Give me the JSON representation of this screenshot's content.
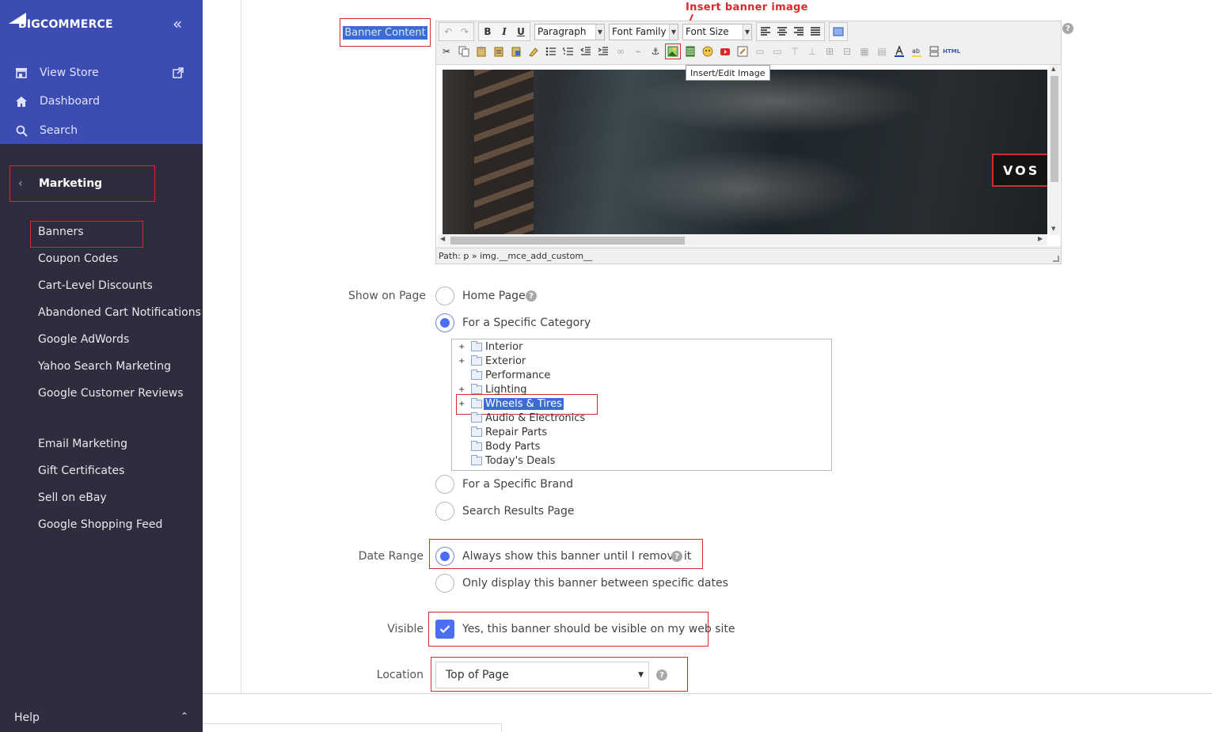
{
  "sidebar": {
    "brand": "BIGCOMMERCE",
    "top_links": [
      {
        "label": "View Store",
        "icon": "storefront-icon"
      },
      {
        "label": "Dashboard",
        "icon": "home-icon"
      },
      {
        "label": "Search",
        "icon": "search-icon"
      }
    ],
    "section": "Marketing",
    "items": [
      "Banners",
      "Coupon Codes",
      "Cart-Level Discounts",
      "Abandoned Cart Notifications",
      "Google AdWords",
      "Yahoo Search Marketing",
      "Google Customer Reviews",
      "Email Marketing",
      "Gift Certificates",
      "Sell on eBay",
      "Google Shopping Feed"
    ],
    "help": "Help"
  },
  "annotation": "Insert banner image",
  "form": {
    "banner_content_label": "Banner Content",
    "editor": {
      "format_select": "Paragraph",
      "font_family_select": "Font Family",
      "font_size_select": "Font Size",
      "tooltip": "Insert/Edit Image",
      "path": "Path: p » img.__mce_add_custom__",
      "image_text": "VOS"
    },
    "show_on_page_label": "Show on Page",
    "show_on_page_options": [
      "Home Page",
      "For a Specific Category",
      "For a Specific Brand",
      "Search Results Page"
    ],
    "categories": [
      {
        "name": "Interior",
        "expandable": true
      },
      {
        "name": "Exterior",
        "expandable": true
      },
      {
        "name": "Performance",
        "expandable": false
      },
      {
        "name": "Lighting",
        "expandable": true
      },
      {
        "name": "Wheels & Tires",
        "expandable": true,
        "selected": true
      },
      {
        "name": "Audio & Electronics",
        "expandable": false
      },
      {
        "name": "Repair Parts",
        "expandable": false
      },
      {
        "name": "Body Parts",
        "expandable": false
      },
      {
        "name": "Today's Deals",
        "expandable": false
      }
    ],
    "date_range_label": "Date Range",
    "date_range_options": [
      "Always show this banner until I remove it",
      "Only display this banner between specific dates"
    ],
    "visible_label": "Visible",
    "visible_text": "Yes, this banner should be visible on my web site",
    "location_label": "Location",
    "location_value": "Top of Page"
  },
  "colors": {
    "sidebar_top": "#3c4cb3",
    "sidebar": "#2d2d3d",
    "accent": "#4c6ef5",
    "annotation_red": "#d62b2b"
  }
}
